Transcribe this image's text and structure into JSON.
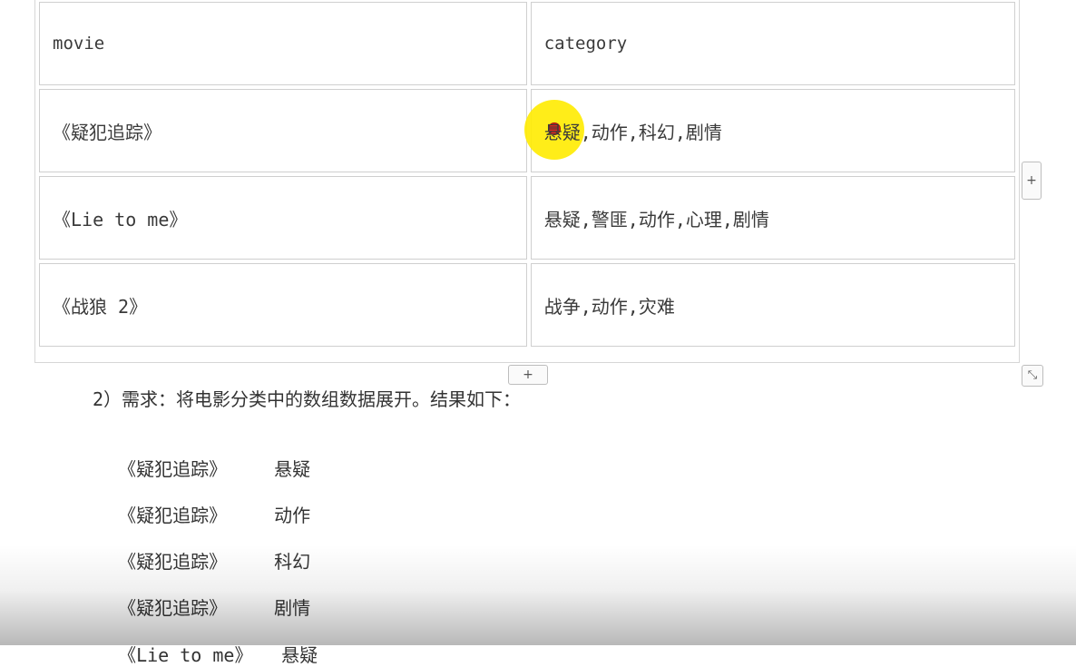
{
  "table": {
    "headers": [
      "movie",
      "category"
    ],
    "rows": [
      [
        "《疑犯追踪》",
        "悬疑,动作,科幻,剧情"
      ],
      [
        "《Lie to me》",
        "悬疑,警匪,动作,心理,剧情"
      ],
      [
        "《战狼 2》",
        "战争,动作,灾难"
      ]
    ]
  },
  "controls": {
    "add_column": "+",
    "add_row": "+",
    "resize": "⤡"
  },
  "requirement": "2）需求：将电影分类中的数组数据展开。结果如下：",
  "results": [
    {
      "movie": "《疑犯追踪》",
      "category": "悬疑"
    },
    {
      "movie": "《疑犯追踪》",
      "category": "动作"
    },
    {
      "movie": "《疑犯追踪》",
      "category": "科幻"
    },
    {
      "movie": "《疑犯追踪》",
      "category": "剧情"
    },
    {
      "movie": "《Lie to me》",
      "category": "悬疑"
    }
  ]
}
